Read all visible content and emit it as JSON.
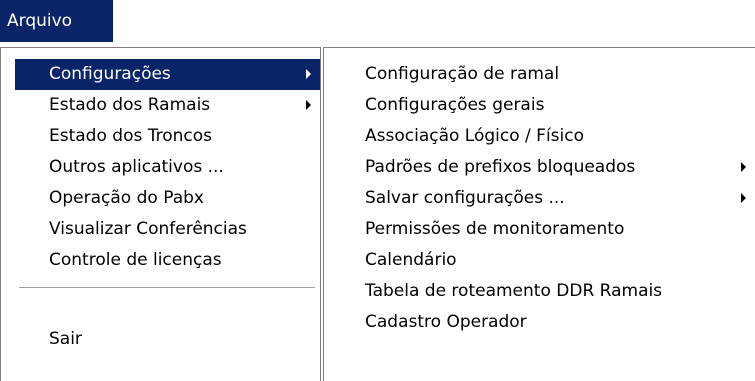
{
  "colors": {
    "highlight": "#0a246a",
    "menu_background": "#ffffff",
    "border": "#808080"
  },
  "menubar": {
    "arquivo_label": "Arquivo"
  },
  "main_menu": {
    "items": [
      {
        "label": "Configurações",
        "has_submenu": true,
        "selected": true
      },
      {
        "label": "Estado dos Ramais",
        "has_submenu": true
      },
      {
        "label": "Estado dos Troncos"
      },
      {
        "label": "Outros aplicativos ..."
      },
      {
        "label": "Operação do Pabx"
      },
      {
        "label": "Visualizar Conferências"
      },
      {
        "label": "Controle de licenças"
      },
      {
        "label": "Sair"
      }
    ]
  },
  "submenu_configuracoes": {
    "items": [
      {
        "label": "Configuração de ramal"
      },
      {
        "label": "Configurações gerais"
      },
      {
        "label": "Associação Lógico / Físico"
      },
      {
        "label": "Padrões de prefixos bloqueados",
        "has_submenu": true
      },
      {
        "label": "Salvar configurações ...",
        "has_submenu": true
      },
      {
        "label": "Permissões de monitoramento"
      },
      {
        "label": "Calendário"
      },
      {
        "label": "Tabela de roteamento DDR Ramais"
      },
      {
        "label": "Cadastro Operador"
      }
    ]
  }
}
